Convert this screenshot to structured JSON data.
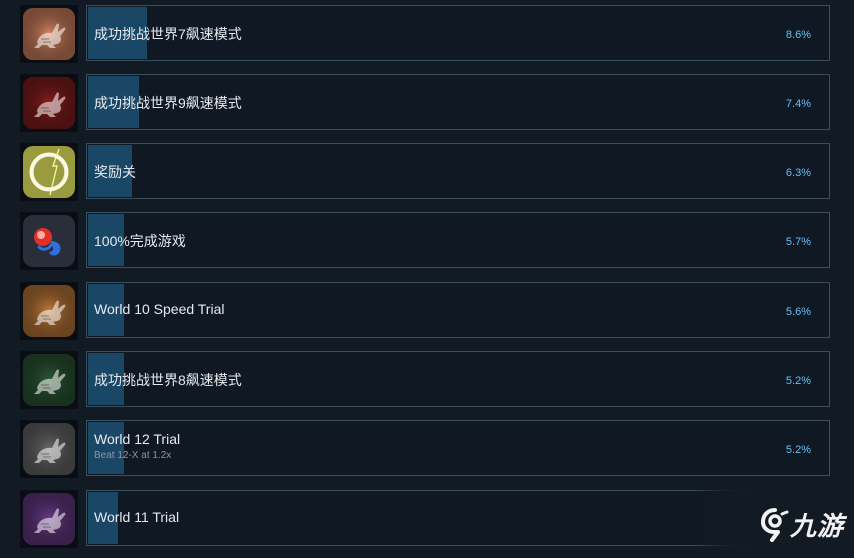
{
  "achievements": [
    {
      "title": "成功挑战世界7飙速模式",
      "description": "",
      "percent_text": "8.6%",
      "percent": 8.6,
      "icon": "rabbit-icon",
      "icon_color": "#d98762",
      "bar_fill": 0.08
    },
    {
      "title": "成功挑战世界9飙速模式",
      "description": "",
      "percent_text": "7.4%",
      "percent": 7.4,
      "icon": "rabbit-icon",
      "icon_color": "#8a1e1e",
      "bar_fill": 0.069
    },
    {
      "title": "奖励关",
      "description": "",
      "percent_text": "6.3%",
      "percent": 6.3,
      "icon": "glowing-ring-icon",
      "icon_color": "#9a9a3e",
      "bar_fill": 0.059
    },
    {
      "title": "100%完成游戏",
      "description": "",
      "percent_text": "5.7%",
      "percent": 5.7,
      "icon": "orb-icon",
      "icon_color": "#2a2d3a",
      "bar_fill": 0.049
    },
    {
      "title": "World 10 Speed Trial",
      "description": "",
      "percent_text": "5.6%",
      "percent": 5.6,
      "icon": "rabbit-icon",
      "icon_color": "#c47c3b",
      "bar_fill": 0.049
    },
    {
      "title": "成功挑战世界8飙速模式",
      "description": "",
      "percent_text": "5.2%",
      "percent": 5.2,
      "icon": "rabbit-icon",
      "icon_color": "#2c5a36",
      "bar_fill": 0.049
    },
    {
      "title": "World 12 Trial",
      "description": "Beat 12-X at 1.2x",
      "percent_text": "5.2%",
      "percent": 5.2,
      "icon": "rabbit-icon",
      "icon_color": "#6b6b6b",
      "bar_fill": 0.049
    },
    {
      "title": "World 11 Trial",
      "description": "",
      "percent_text": "",
      "percent": null,
      "icon": "rabbit-icon",
      "icon_color": "#6a3c8a",
      "bar_fill": 0.04
    }
  ],
  "watermark": {
    "text": "九游",
    "icon": "ninegame-logo-icon"
  },
  "colors": {
    "background": "#121a24",
    "bar_border": "#3a4e5e",
    "bar_fill": "#1b4767",
    "percent_text": "#66c0f4",
    "title_text": "#e6eaee"
  }
}
